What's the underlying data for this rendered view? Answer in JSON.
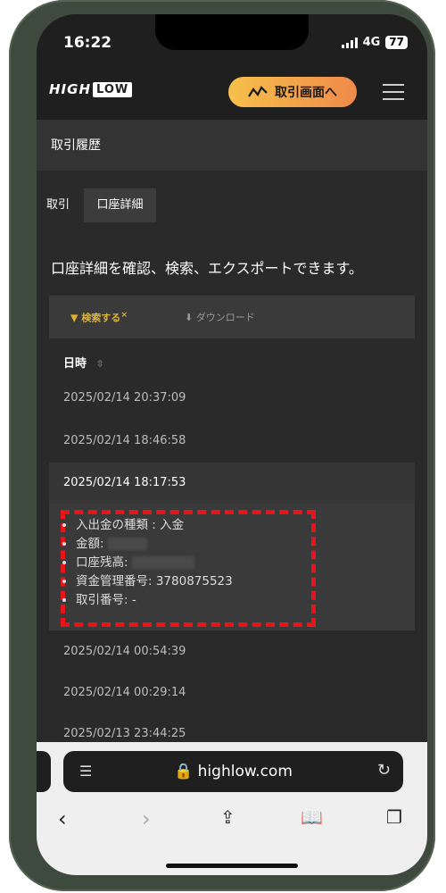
{
  "status": {
    "time": "16:22",
    "network": "4G",
    "battery": "77"
  },
  "header": {
    "logo_high": "HIGH",
    "logo_low": "LOW",
    "trade_button": "取引画面へ"
  },
  "page": {
    "title": "取引履歴"
  },
  "tabs": [
    {
      "label": "取引"
    },
    {
      "label": "口座詳細"
    }
  ],
  "description": "口座詳細を確認、検索、エクスポートできます。",
  "toolbar": {
    "search": "検索する",
    "search_mark": "×",
    "download": "ダウンロード"
  },
  "table": {
    "column": "日時",
    "rows": [
      "2025/02/14 20:37:09",
      "2025/02/14 18:46:58",
      "2025/02/14 18:17:53",
      "2025/02/14 00:54:39",
      "2025/02/14 00:29:14",
      "2025/02/13 23:44:25"
    ]
  },
  "detail": {
    "type_label": "入出金の種類 : 入金",
    "amount_label": "金額:",
    "balance_label": "口座残高:",
    "fund_id_label": "資金管理番号: 3780875523",
    "trade_no_label": "取引番号: -"
  },
  "browser": {
    "url": "highlow.com"
  },
  "colors": {
    "accent": "#e0b22e",
    "highlight_box": "#e8141a"
  }
}
